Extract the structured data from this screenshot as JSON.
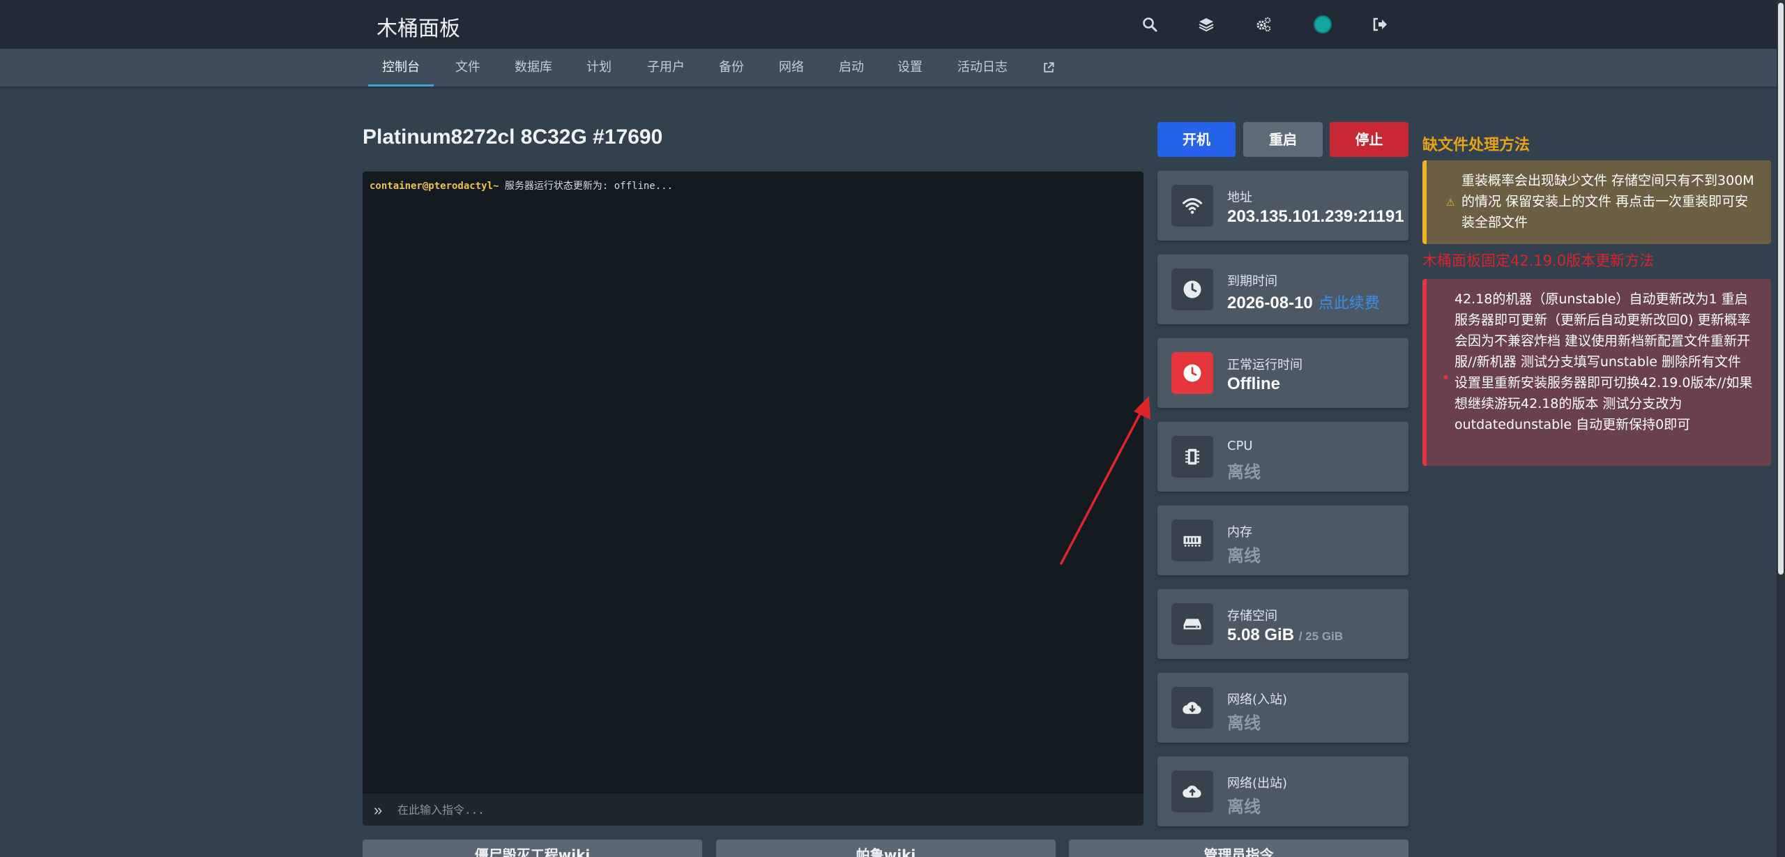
{
  "header": {
    "brand": "木桶面板",
    "icons": [
      "search-icon",
      "layers-icon",
      "cogs-icon",
      "avatar",
      "logout-icon"
    ]
  },
  "nav": {
    "tabs": [
      {
        "label": "控制台",
        "active": true
      },
      {
        "label": "文件"
      },
      {
        "label": "数据库"
      },
      {
        "label": "计划"
      },
      {
        "label": "子用户"
      },
      {
        "label": "备份"
      },
      {
        "label": "网络"
      },
      {
        "label": "启动"
      },
      {
        "label": "设置"
      },
      {
        "label": "活动日志"
      }
    ],
    "external_icon": "external-link-icon"
  },
  "server": {
    "title": "Platinum8272cl 8C32G #17690"
  },
  "console": {
    "prompt": "container@pterodactyl~",
    "line": " 服务器运行状态更新为: offline...",
    "input_placeholder": "在此输入指令..."
  },
  "power": {
    "start": "开机",
    "restart": "重启",
    "stop": "停止"
  },
  "stats": {
    "address": {
      "label": "地址",
      "value": "203.135.101.239:21191"
    },
    "expiry": {
      "label": "到期时间",
      "value": "2026-08-10",
      "renew": "点此续费"
    },
    "uptime": {
      "label": "正常运行时间",
      "value": "Offline"
    },
    "cpu": {
      "label": "CPU",
      "value": "离线"
    },
    "memory": {
      "label": "内存",
      "value": "离线"
    },
    "disk": {
      "label": "存储空间",
      "value": "5.08 GiB",
      "limit": "/ 25 GiB"
    },
    "net_in": {
      "label": "网络(入站)",
      "value": "离线"
    },
    "net_out": {
      "label": "网络(出站)",
      "value": "离线"
    }
  },
  "notes": {
    "warn_title": "缺文件处理方法",
    "warn_text": "重装概率会出现缺少文件 存储空间只有不到300M的情况 保留安装上的文件 再点击一次重装即可安装全部文件",
    "danger_title": "木桶面板固定42.19.0版本更新方法",
    "danger_text": "42.18的机器（原unstable）自动更新改为1 重启服务器即可更新（更新后自动更新改回0) 更新概率会因为不兼容炸档 建议使用新档新配置文件重新开服//新机器 测试分支填写unstable 删除所有文件 设置里重新安装服务器即可切换42.19.0版本//如果想继续游玩42.18的版本 测试分支改为outdatedunstable 自动更新保持0即可"
  },
  "bottom_buttons": [
    "僵尸毁灭工程wiki",
    "帕鲁wiki",
    "管理员指令"
  ],
  "colors": {
    "start": "#2563eb",
    "stop": "#c82834",
    "accent_tab": "#3fa2d8",
    "warn": "#f0b429",
    "danger": "#e03542"
  }
}
